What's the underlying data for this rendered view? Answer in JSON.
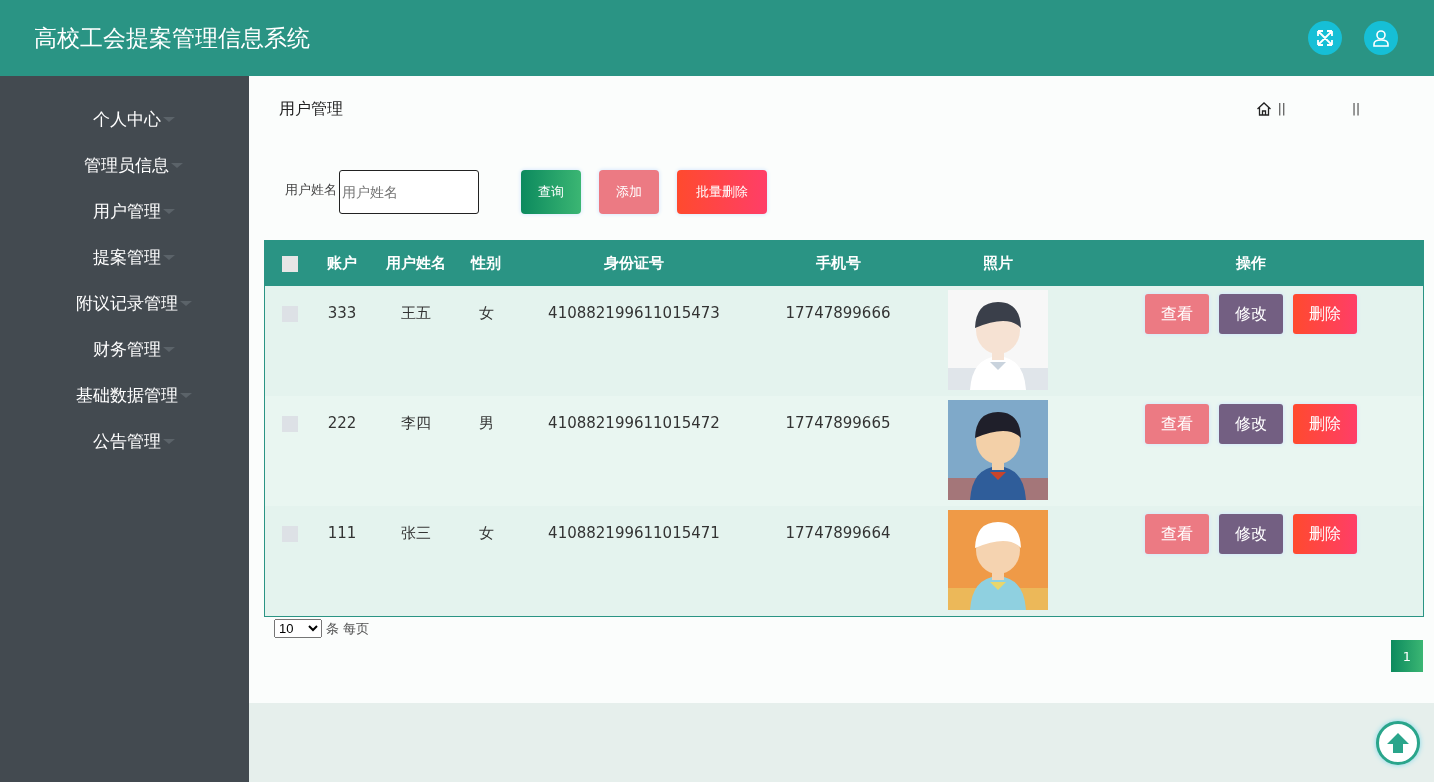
{
  "header": {
    "title": "高校工会提案管理信息系统"
  },
  "sidebar": {
    "items": [
      {
        "label": "个人中心"
      },
      {
        "label": "管理员信息"
      },
      {
        "label": "用户管理"
      },
      {
        "label": "提案管理"
      },
      {
        "label": "附议记录管理"
      },
      {
        "label": "财务管理"
      },
      {
        "label": "基础数据管理"
      },
      {
        "label": "公告管理"
      }
    ]
  },
  "page_title": "用户管理",
  "breadcrumb": [
    "||",
    "||"
  ],
  "search": {
    "label": "用户姓名",
    "placeholder": "用户姓名"
  },
  "buttons": [
    {
      "label": "查询",
      "kind": "query"
    },
    {
      "label": "添加",
      "kind": "add"
    },
    {
      "label": "批量删除",
      "kind": "delete"
    }
  ],
  "table": {
    "select_all": {
      "checked": false
    },
    "columns": [
      "账户",
      "用户姓名",
      "性别",
      "身份证号",
      "手机号",
      "照片",
      "操作"
    ],
    "rows": [
      {
        "checked": false,
        "cells": [
          "333",
          "王五",
          "女",
          "410882199611015473",
          "17747899666"
        ],
        "actions": [
          "查看",
          "修改",
          "删除"
        ]
      },
      {
        "checked": false,
        "cells": [
          "222",
          "李四",
          "男",
          "410882199611015472",
          "17747899665"
        ],
        "actions": [
          "查看",
          "修改",
          "删除"
        ]
      },
      {
        "checked": false,
        "cells": [
          "111",
          "张三",
          "女",
          "410882199611015471",
          "17747899664"
        ],
        "actions": [
          "查看",
          "修改",
          "删除"
        ]
      }
    ]
  },
  "pagination": {
    "page_size": "10",
    "page_size_suffix": "条 每页",
    "pages": [
      {
        "label": "1",
        "selected": true
      }
    ]
  }
}
